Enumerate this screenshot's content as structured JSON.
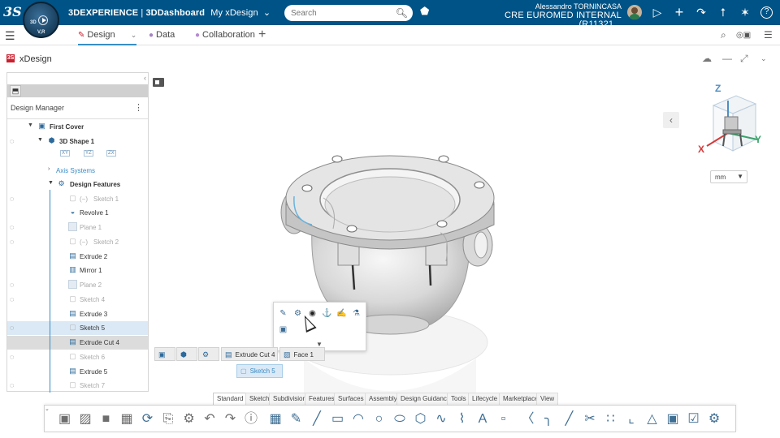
{
  "topbar": {
    "logo": "3S",
    "compass": {
      "q1": "3D",
      "q2": "V,R",
      "q3": "",
      "q4": ""
    },
    "brand": "3DEXPERIENCE",
    "app": "3DDashboard",
    "dashboard": "My xDesign",
    "search_placeholder": "Search",
    "user_name": "Alessandro TORNINCASA",
    "tenant": "CRE EUROMED INTERNAL (R11321 ..",
    "icons": [
      "tag-icon",
      "share-icon",
      "add-icon",
      "forward-icon",
      "network-icon",
      "compass-tools-icon",
      "help-icon"
    ]
  },
  "secbar": {
    "tabs": [
      {
        "label": "Design",
        "active": true
      },
      {
        "label": "Data",
        "active": false
      },
      {
        "label": "Collaboration",
        "active": false
      }
    ]
  },
  "appbar": {
    "title": "xDesign"
  },
  "design_manager": {
    "title": "Design Manager",
    "tree": [
      {
        "label": "First Cover",
        "style": "bold",
        "eye": false
      },
      {
        "label": "3D Shape 1",
        "style": "bold",
        "eye": true
      },
      {
        "label": "Axis Systems",
        "style": "link",
        "eye": false
      },
      {
        "label": "Design Features",
        "style": "bold",
        "eye": false
      },
      {
        "label": "Sketch 1",
        "style": "dim",
        "eye": true
      },
      {
        "label": "Revolve 1",
        "style": "norm",
        "eye": false
      },
      {
        "label": "Plane 1",
        "style": "dim",
        "eye": true
      },
      {
        "label": "Sketch 2",
        "style": "dim",
        "eye": true
      },
      {
        "label": "Extrude 2",
        "style": "norm",
        "eye": false
      },
      {
        "label": "Mirror 1",
        "style": "norm",
        "eye": false
      },
      {
        "label": "Plane 2",
        "style": "dim",
        "eye": true
      },
      {
        "label": "Sketch 4",
        "style": "dim",
        "eye": true
      },
      {
        "label": "Extrude 3",
        "style": "norm",
        "eye": false
      },
      {
        "label": "Sketch 5",
        "style": "sel",
        "eye": true
      },
      {
        "label": "Extrude Cut 4",
        "style": "hov",
        "eye": false
      },
      {
        "label": "Sketch 6",
        "style": "dim",
        "eye": true
      },
      {
        "label": "Extrude 5",
        "style": "norm",
        "eye": false
      },
      {
        "label": "Sketch 7",
        "style": "dim",
        "eye": true
      }
    ],
    "axis_chips": [
      "XY",
      "YZ",
      "ZX"
    ]
  },
  "viewport": {
    "unit": "mm",
    "axes": {
      "z": "Z",
      "x": "X",
      "y": "Y"
    },
    "breadcrumbs": [
      "Extrude Cut 4",
      "Face 1"
    ],
    "selected": "Sketch 5"
  },
  "action_bar": {
    "tabs": [
      "Standard",
      "Sketch",
      "Subdivision",
      "Features",
      "Surfaces",
      "Assembly",
      "Design Guidance",
      "Tools",
      "Lifecycle",
      "Marketplace",
      "View"
    ],
    "active_tab": "Standard"
  },
  "colors": {
    "topbar": "#005386",
    "accent": "#368ec4",
    "selection": "#dbe9f6"
  }
}
